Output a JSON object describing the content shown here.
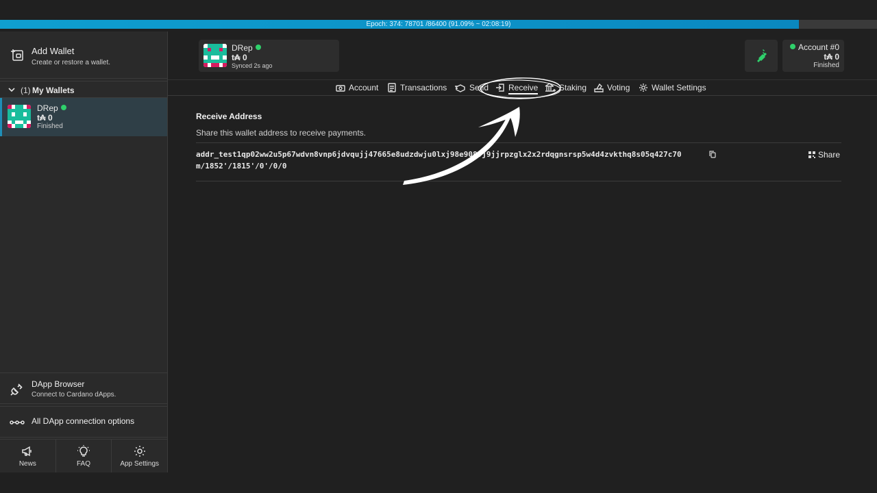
{
  "epoch": {
    "text": "Epoch: 374: 78701 /86400 (91.09% ~ 02:08:19)",
    "progress_percent": 91.09,
    "color": "#0f9fd0"
  },
  "sidebar": {
    "add_wallet": {
      "title": "Add Wallet",
      "subtitle": "Create or restore a wallet.",
      "icon": "add-wallet-icon"
    },
    "my_wallets": {
      "count": "(1)",
      "label": "My Wallets"
    },
    "wallet": {
      "name": "DRep",
      "balance": "t₳ 0",
      "status": "Finished"
    },
    "dapp_browser": {
      "title": "DApp Browser",
      "subtitle": "Connect to Cardano dApps."
    },
    "dapp_options": {
      "title": "All DApp connection options"
    },
    "bottom_nav": [
      {
        "label": "News",
        "icon": "megaphone-icon"
      },
      {
        "label": "FAQ",
        "icon": "lightbulb-icon"
      },
      {
        "label": "App Settings",
        "icon": "gear-icon"
      }
    ]
  },
  "header": {
    "wallet_card": {
      "name": "DRep",
      "balance": "t₳ 0",
      "sync": "Synced 2s ago"
    },
    "account_card": {
      "name": "Account #0",
      "balance": "t₳ 0",
      "status": "Finished"
    }
  },
  "tabs": [
    {
      "label": "Account",
      "icon": "account-icon"
    },
    {
      "label": "Transactions",
      "icon": "transactions-icon"
    },
    {
      "label": "Send",
      "icon": "send-icon"
    },
    {
      "label": "Receive",
      "icon": "receive-icon",
      "active": true
    },
    {
      "label": "Staking",
      "icon": "staking-icon"
    },
    {
      "label": "Voting",
      "icon": "voting-icon"
    },
    {
      "label": "Wallet Settings",
      "icon": "gear-icon"
    }
  ],
  "receive": {
    "title": "Receive Address",
    "description": "Share this wallet address to receive payments.",
    "address": "addr_test1qp02ww2u5p67wdvn8vnp6jdvqujj47665e8udzdwju0lxj98e9​08vj9jjrpzglx2x2rdqgnsrsp5w4d4zvkthq8s05q427c70",
    "path": "m/1852'/1815'/0'/0/0",
    "share_label": "Share"
  },
  "colors": {
    "accent_green": "#2fd06b",
    "selected_wallet_bg": "#2f3f47",
    "background": "#202020"
  }
}
